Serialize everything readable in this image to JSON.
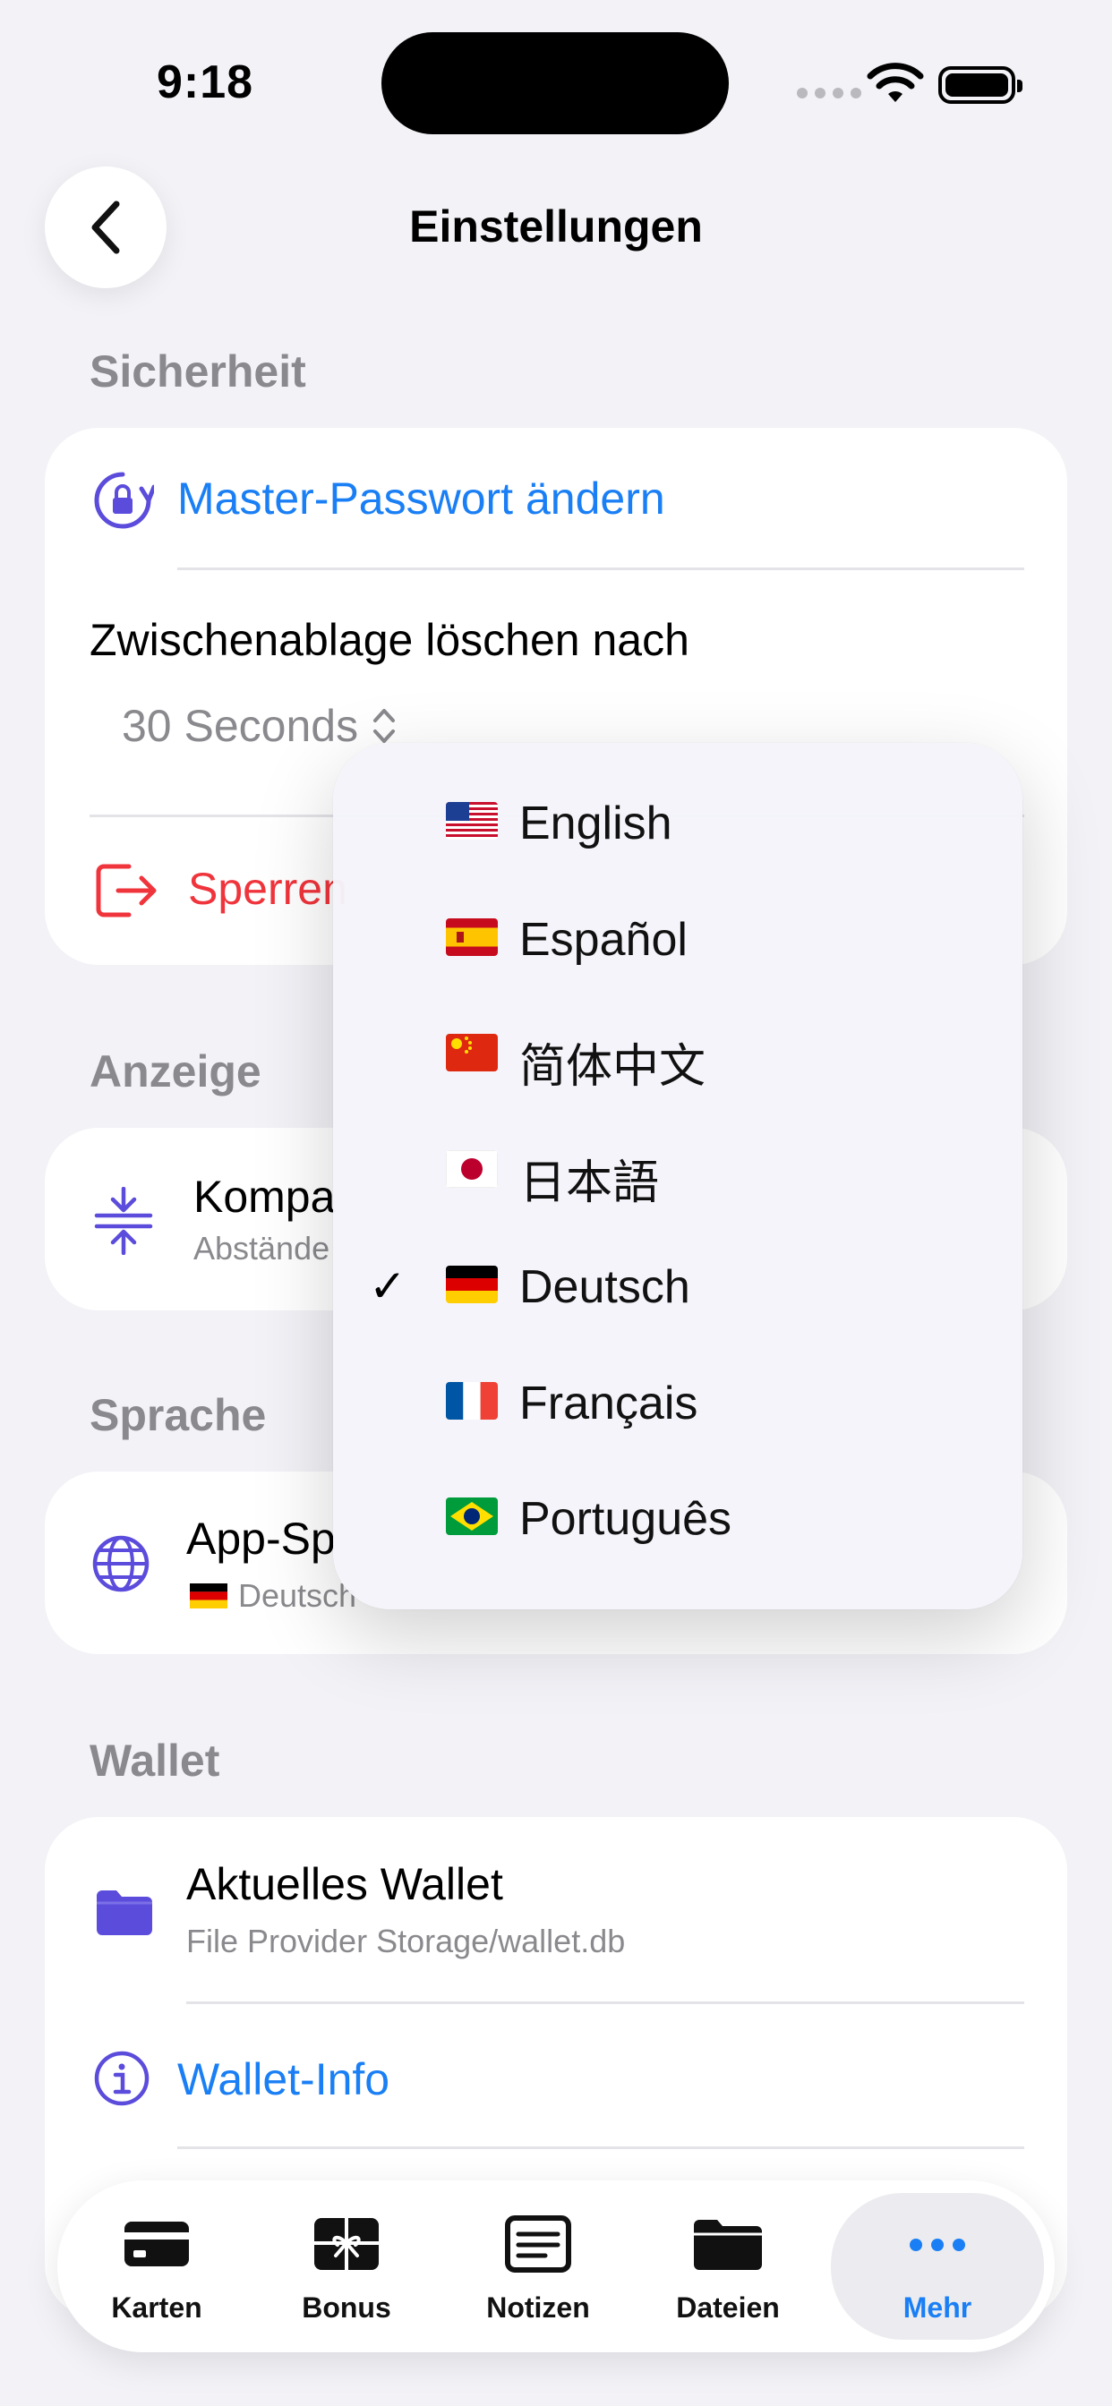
{
  "status_bar": {
    "time": "9:18"
  },
  "nav": {
    "title": "Einstellungen"
  },
  "security": {
    "header": "Sicherheit",
    "change_password": "Master-Passwort ändern",
    "clipboard_label": "Zwischenablage löschen nach",
    "clipboard_value": "30 Seconds",
    "lock_label_visible": "Sperren"
  },
  "display": {
    "header": "Anzeige",
    "compact_title_visible": "Kompa",
    "compact_sub_visible": "Abstände"
  },
  "language": {
    "header": "Sprache",
    "app_language_visible": "App-Sp",
    "current_flag": "🇩🇪",
    "current_value": "Deutsch"
  },
  "wallet": {
    "header": "Wallet",
    "current_title": "Aktuelles Wallet",
    "current_path": "File Provider Storage/wallet.db",
    "info": "Wallet-Info"
  },
  "language_menu": {
    "selected_index": 4,
    "items": [
      {
        "label": "English",
        "flag": "us"
      },
      {
        "label": "Español",
        "flag": "es"
      },
      {
        "label": "简体中文",
        "flag": "cn"
      },
      {
        "label": "日本語",
        "flag": "jp"
      },
      {
        "label": "Deutsch",
        "flag": "de"
      },
      {
        "label": "Français",
        "flag": "fr"
      },
      {
        "label": "Português",
        "flag": "br"
      }
    ],
    "check_glyph": "✓"
  },
  "tabbar": {
    "active": "Mehr",
    "tabs": [
      {
        "label": "Karten",
        "icon": "card-icon"
      },
      {
        "label": "Bonus",
        "icon": "gift-icon"
      },
      {
        "label": "Notizen",
        "icon": "notes-icon"
      },
      {
        "label": "Dateien",
        "icon": "folder-icon"
      },
      {
        "label": "Mehr",
        "icon": "more-icon"
      }
    ]
  },
  "colors": {
    "accent": "#1a7ff5",
    "destructive": "#f0343c",
    "icon_purple": "#5b4cdc"
  }
}
